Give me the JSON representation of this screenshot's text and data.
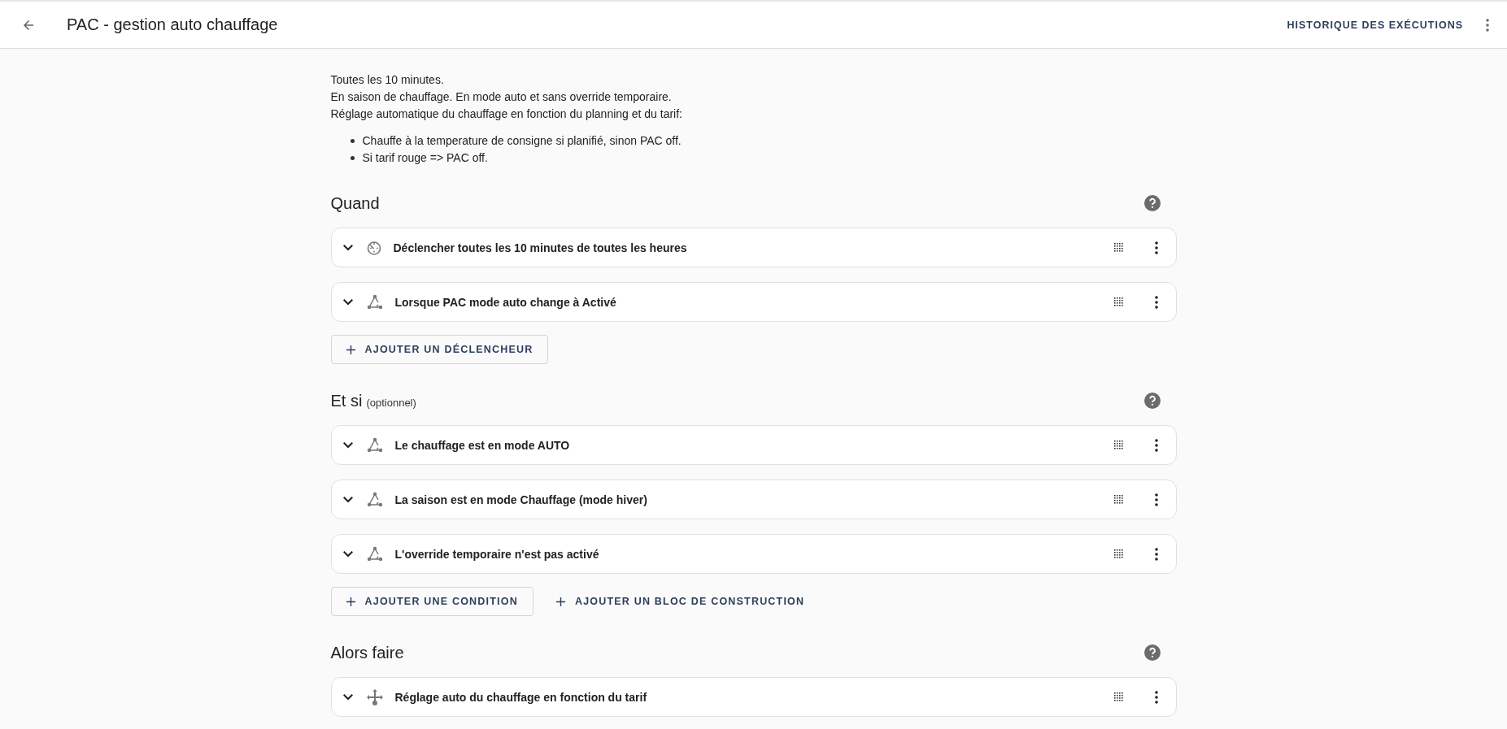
{
  "toolbar": {
    "title": "PAC - gestion auto chauffage",
    "action": "HISTORIQUE DES EXÉCUTIONS"
  },
  "description": {
    "lines": [
      "Toutes les 10 minutes.",
      "En saison de chauffage. En mode auto et sans override temporaire.",
      "Réglage automatique du chauffage en fonction du planning et du tarif:"
    ],
    "bullets": [
      "Chauffe à la temperature de consigne si planifié, sinon PAC off.",
      "Si tarif rouge => PAC off."
    ]
  },
  "sections": [
    {
      "title": "Quand",
      "rows": [
        {
          "kind": "time",
          "label": "Déclencher toutes les 10 minutes de toutes les heures"
        },
        {
          "kind": "state",
          "label": "Lorsque PAC mode auto change à Activé"
        }
      ],
      "buttons": [
        {
          "kind": "outlined",
          "label": "AJOUTER UN DÉCLENCHEUR"
        }
      ]
    },
    {
      "title": "Et si",
      "subtitle": "(optionnel)",
      "rows": [
        {
          "kind": "state",
          "label": "Le chauffage est en mode AUTO"
        },
        {
          "kind": "state",
          "label": "La saison est en mode Chauffage (mode hiver)"
        },
        {
          "kind": "state",
          "label": "L'override temporaire n'est pas activé"
        }
      ],
      "buttons": [
        {
          "kind": "outlined",
          "label": "AJOUTER UNE CONDITION"
        },
        {
          "kind": "text",
          "label": "AJOUTER UN BLOC DE CONSTRUCTION"
        }
      ]
    },
    {
      "title": "Alors faire",
      "rows": [
        {
          "kind": "action",
          "label": "Réglage auto du chauffage en fonction du tarif"
        }
      ]
    }
  ]
}
